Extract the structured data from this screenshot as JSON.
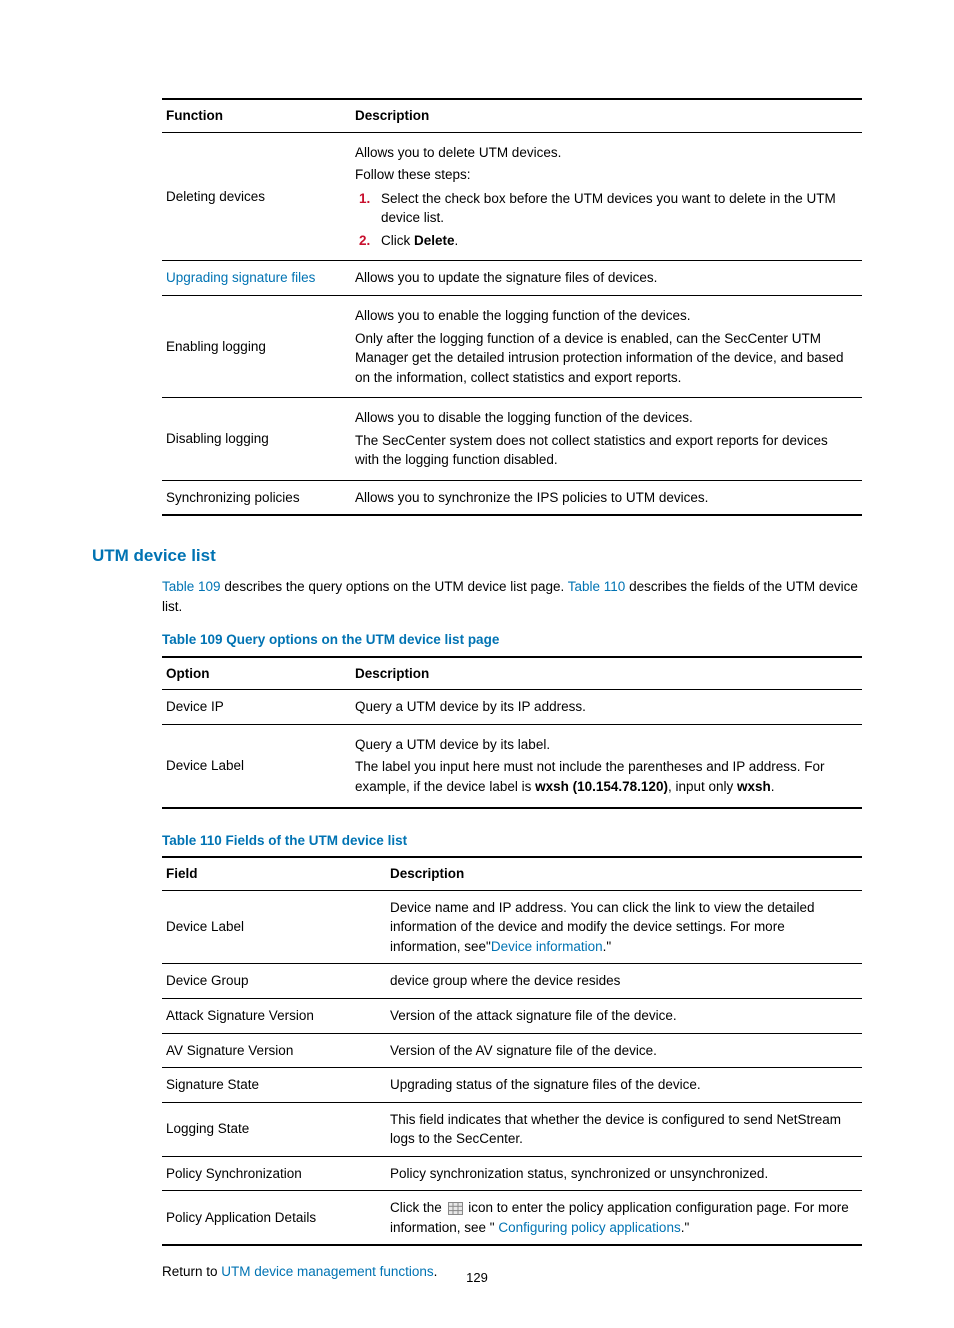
{
  "table1": {
    "headers": [
      "Function",
      "Description"
    ],
    "rows": [
      {
        "func": "Deleting devices",
        "desc": {
          "intro": "Allows you to delete UTM devices.",
          "steps_label": "Follow these steps:",
          "steps": [
            {
              "pre": "Select the check box before the UTM devices you want to delete in the UTM device list."
            },
            {
              "pre": "Click ",
              "bold": "Delete",
              "post": "."
            }
          ]
        }
      },
      {
        "func_link": "Upgrading signature files",
        "desc_plain": "Allows you to update the signature files of devices."
      },
      {
        "func": "Enabling logging",
        "desc_multi": [
          "Allows you to enable the logging function of the devices.",
          "Only after the logging function of a device is enabled, can the SecCenter UTM Manager get the detailed intrusion protection information of the device, and based on the information, collect statistics and export reports."
        ]
      },
      {
        "func": "Disabling logging",
        "desc_multi": [
          "Allows you to disable the logging function of the devices.",
          "The SecCenter system does not collect statistics and export reports for devices with the logging function disabled."
        ]
      },
      {
        "func": "Synchronizing policies",
        "desc_plain": "Allows you to synchronize the IPS policies to UTM devices."
      }
    ]
  },
  "section1": {
    "heading": "UTM device list",
    "para": {
      "p1a": "Table 109",
      "p1b": " describes the query options on the UTM device list page. ",
      "p1c": "Table 110",
      "p1d": " describes the fields of the UTM device list."
    }
  },
  "table2": {
    "title": "Table 109 Query options on the UTM device list page",
    "headers": [
      "Option",
      "Description"
    ],
    "rows": [
      {
        "opt": "Device IP",
        "desc_plain": "Query a UTM device by its IP address."
      },
      {
        "opt": "Device Label",
        "desc": {
          "line1": "Query a UTM device by its label.",
          "line2a": "The label you input here must not include the parentheses and IP address. For example, if the device label is ",
          "line2b": "wxsh (10.154.78.120)",
          "line2c": ", input only ",
          "line2d": "wxsh",
          "line2e": "."
        }
      }
    ]
  },
  "table3": {
    "title": "Table 110 Fields of the UTM device list",
    "headers": [
      "Field",
      "Description"
    ],
    "rows": [
      {
        "fld": "Device Label",
        "desc": {
          "a": "Device name and IP address. You can click the link to view the detailed information of the device and modify the device settings. For more information, see\"",
          "link": "Device information",
          "b": ".\""
        }
      },
      {
        "fld": "Device Group",
        "desc_plain": "device group where the device resides"
      },
      {
        "fld": "Attack Signature Version",
        "desc_plain": "Version of the attack signature file of the device."
      },
      {
        "fld": "AV Signature Version",
        "desc_plain": "Version of the AV signature file of the device."
      },
      {
        "fld": "Signature State",
        "desc_plain": "Upgrading status of the signature files of the device."
      },
      {
        "fld": "Logging State",
        "desc_plain": "This field indicates that whether the device is configured to send NetStream logs to the SecCenter."
      },
      {
        "fld": "Policy Synchronization",
        "desc_plain": "Policy synchronization status, synchronized or unsynchronized."
      },
      {
        "fld": "Policy Application Details",
        "desc": {
          "a": "Click the ",
          "icon": "grid-icon",
          "b": " icon to enter the policy application configuration page. For more information, see \" ",
          "link": "Configuring policy applications",
          "c": ".\""
        }
      }
    ]
  },
  "return": {
    "pre": "Return to ",
    "link": "UTM device management functions",
    "post": "."
  },
  "page_number": "129"
}
